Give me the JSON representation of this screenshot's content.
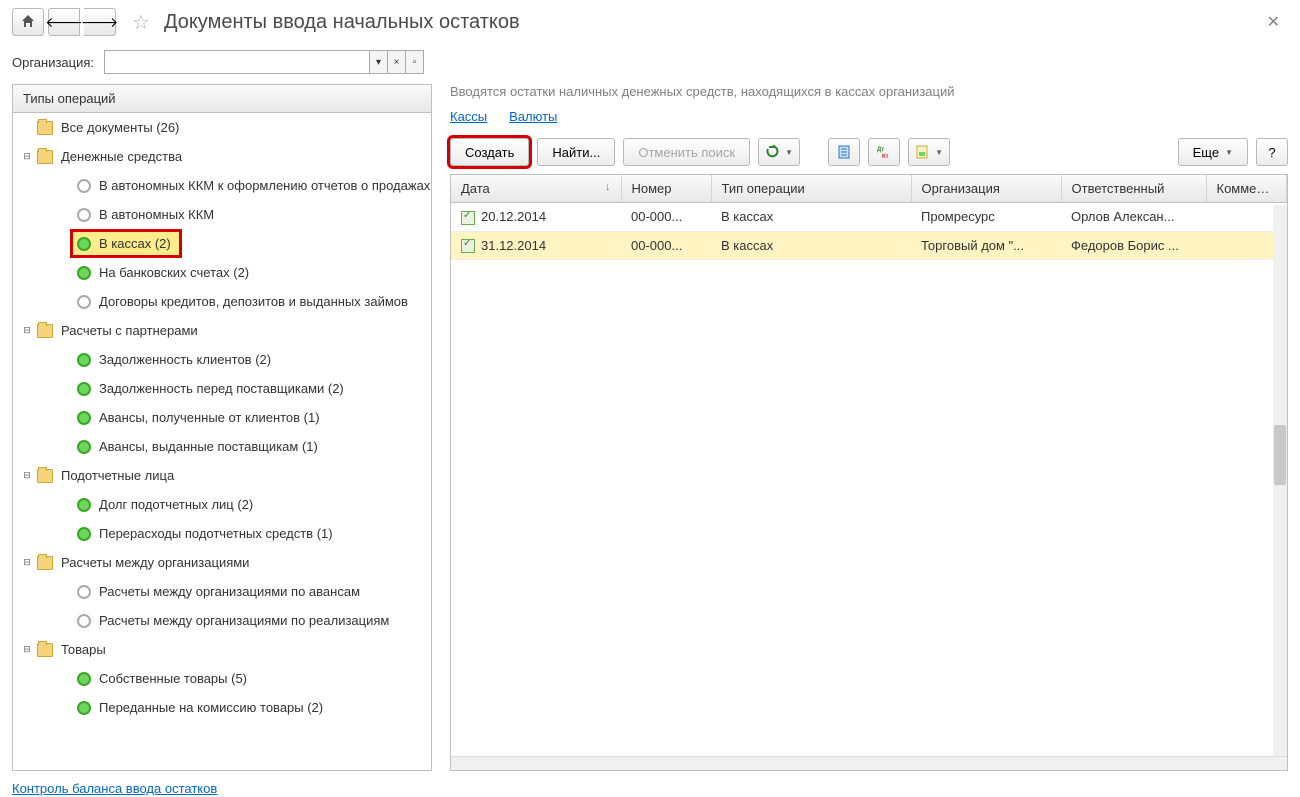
{
  "title": "Документы ввода начальных остатков",
  "org_label": "Организация:",
  "tree_header": "Типы операций",
  "tree": [
    {
      "level": 0,
      "expander": "",
      "icon": "folder",
      "label": "Все документы (26)"
    },
    {
      "level": 0,
      "expander": "–",
      "icon": "folder",
      "label": "Денежные средства"
    },
    {
      "level": 1,
      "expander": "",
      "icon": "empty",
      "label": "В автономных ККМ к оформлению отчетов о продажах"
    },
    {
      "level": 1,
      "expander": "",
      "icon": "empty",
      "label": "В автономных ККМ"
    },
    {
      "level": 1,
      "expander": "",
      "icon": "green",
      "label": "В кассах (2)",
      "selected": true
    },
    {
      "level": 1,
      "expander": "",
      "icon": "green",
      "label": "На банковских счетах (2)"
    },
    {
      "level": 1,
      "expander": "",
      "icon": "empty",
      "label": "Договоры кредитов, депозитов и выданных займов"
    },
    {
      "level": 0,
      "expander": "–",
      "icon": "folder",
      "label": "Расчеты с партнерами"
    },
    {
      "level": 1,
      "expander": "",
      "icon": "green",
      "label": "Задолженность клиентов (2)"
    },
    {
      "level": 1,
      "expander": "",
      "icon": "green",
      "label": "Задолженность перед поставщиками (2)"
    },
    {
      "level": 1,
      "expander": "",
      "icon": "green",
      "label": "Авансы, полученные от клиентов (1)"
    },
    {
      "level": 1,
      "expander": "",
      "icon": "green",
      "label": "Авансы, выданные поставщикам (1)"
    },
    {
      "level": 0,
      "expander": "–",
      "icon": "folder",
      "label": "Подотчетные лица"
    },
    {
      "level": 1,
      "expander": "",
      "icon": "green",
      "label": "Долг подотчетных лиц (2)"
    },
    {
      "level": 1,
      "expander": "",
      "icon": "green",
      "label": "Перерасходы подотчетных средств (1)"
    },
    {
      "level": 0,
      "expander": "–",
      "icon": "folder",
      "label": "Расчеты между организациями"
    },
    {
      "level": 1,
      "expander": "",
      "icon": "empty",
      "label": "Расчеты между организациями по авансам"
    },
    {
      "level": 1,
      "expander": "",
      "icon": "empty",
      "label": "Расчеты между организациями по реализациям"
    },
    {
      "level": 0,
      "expander": "–",
      "icon": "folder",
      "label": "Товары"
    },
    {
      "level": 1,
      "expander": "",
      "icon": "green",
      "label": "Собственные товары (5)"
    },
    {
      "level": 1,
      "expander": "",
      "icon": "green",
      "label": "Переданные на комиссию товары (2)"
    }
  ],
  "bottom_link": "Контроль баланса ввода остатков",
  "hint": "Вводятся остатки наличных денежных средств, находящихся в кассах организаций",
  "tabs": {
    "a": "Кассы",
    "b": "Валюты"
  },
  "toolbar": {
    "create": "Создать",
    "find": "Найти...",
    "cancel_find": "Отменить поиск",
    "more": "Еще"
  },
  "columns": {
    "date": "Дата",
    "number": "Номер",
    "op": "Тип операции",
    "org": "Организация",
    "resp": "Ответственный",
    "comment": "Коммента..."
  },
  "rows": [
    {
      "date": "20.12.2014",
      "number": "00-000...",
      "op": "В кассах",
      "org": "Промресурс",
      "resp": "Орлов Алексан...",
      "hl": false
    },
    {
      "date": "31.12.2014",
      "number": "00-000...",
      "op": "В кассах",
      "org": "Торговый дом \"...",
      "resp": "Федоров Борис ...",
      "hl": true
    }
  ],
  "help_tooltip": "?"
}
